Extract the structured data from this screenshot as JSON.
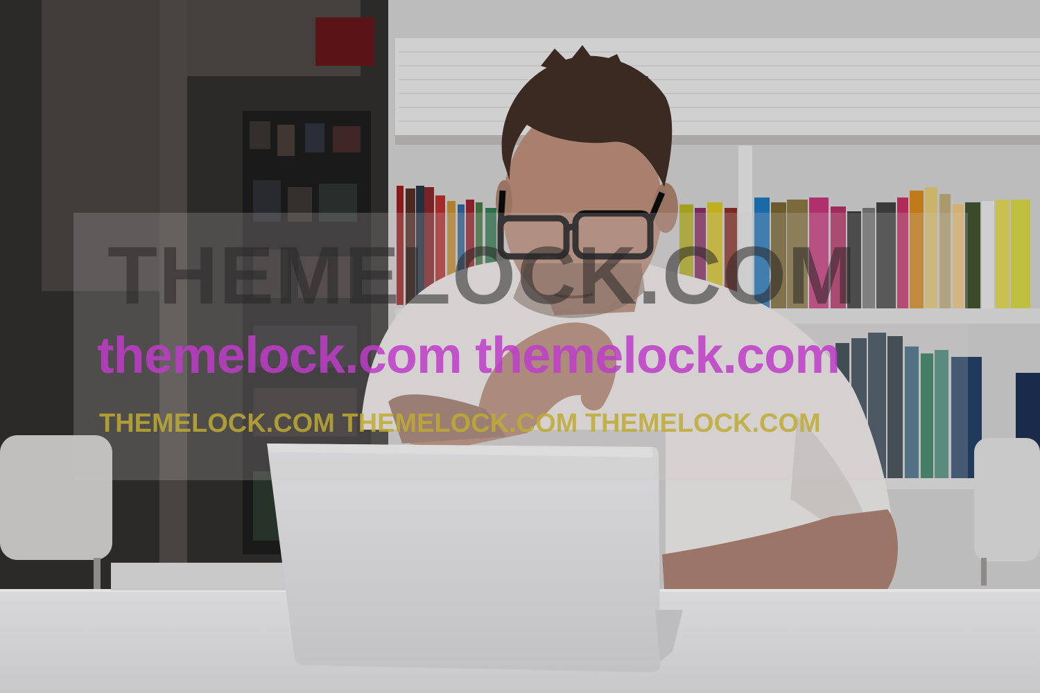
{
  "photo": {
    "subject": "man-with-glasses-using-laptop-icon"
  },
  "watermark": {
    "line1": "THEMELOCK.COM",
    "line2": "themelock.com themelock.com",
    "line3": "THEMELOCK.COM THEMELOCK.COM THEMELOCK.COM",
    "colors": {
      "line1": "#2a2828",
      "line2": "#be3cc8",
      "line3": "#beaa32"
    }
  }
}
